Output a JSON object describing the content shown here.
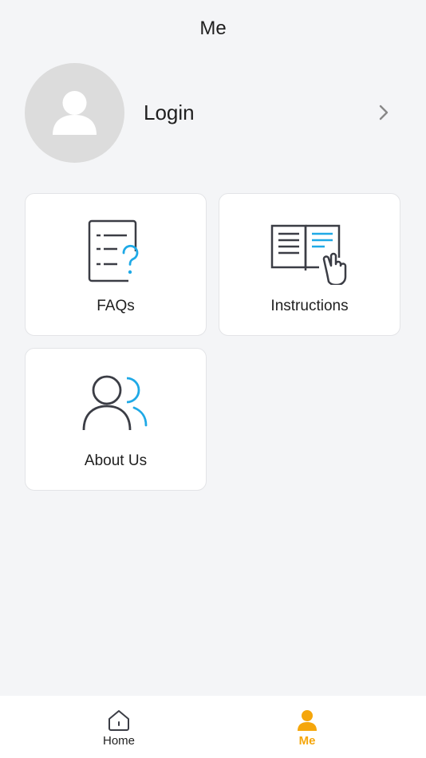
{
  "header": {
    "title": "Me"
  },
  "profile": {
    "login_label": "Login"
  },
  "cards": {
    "faqs": {
      "label": "FAQs",
      "icon": "faq-document-icon"
    },
    "instructions": {
      "label": "Instructions",
      "icon": "instruction-book-icon"
    },
    "about": {
      "label": "About Us",
      "icon": "about-people-icon"
    }
  },
  "tabbar": {
    "home_label": "Home",
    "me_label": "Me",
    "active": "me"
  },
  "colors": {
    "accent": "#f5a60b",
    "icon_blue": "#1fa9e6",
    "icon_dark": "#3b3d45",
    "background": "#f4f5f7"
  }
}
